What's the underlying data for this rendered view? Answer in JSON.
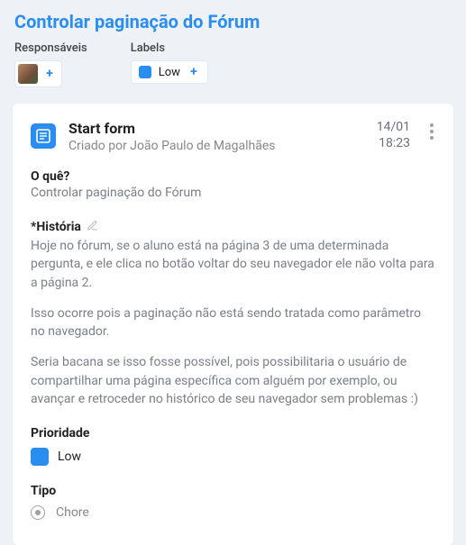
{
  "header": {
    "title": "Controlar paginação do Fórum",
    "responsaveis_label": "Responsáveis",
    "labels_label": "Labels",
    "label_chip": {
      "text": "Low",
      "color": "#2a8ef0"
    }
  },
  "card": {
    "title": "Start form",
    "subtitle": "Criado por João Paulo de Magalhães",
    "date": "14/01",
    "time": "18:23",
    "oque_label": "O quê?",
    "oque_value": "Controlar paginação do Fórum",
    "historia_label": "*História",
    "historia_p1": "Hoje no fórum, se o aluno está na página 3 de uma determinada pergunta, e ele clica no botão voltar do seu navegador ele não volta para a página 2.",
    "historia_p2": "Isso ocorre pois a paginação não está sendo tratada como parâmetro no navegador.",
    "historia_p3": "Seria bacana se isso fosse possível, pois possibilitaria o usuário de compartilhar uma página específica com alguém por exemplo, ou avançar e retroceder no histórico de seu navegador sem problemas :)",
    "prioridade_label": "Prioridade",
    "prioridade_value": "Low",
    "tipo_label": "Tipo",
    "tipo_value": "Chore"
  }
}
